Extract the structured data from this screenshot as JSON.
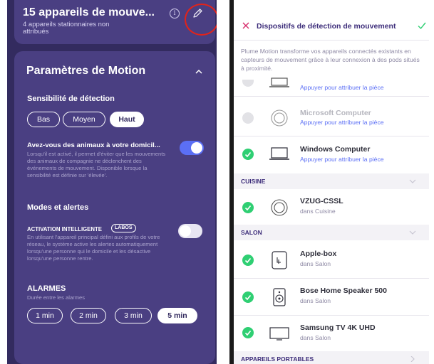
{
  "left_screen": {
    "summary": {
      "title": "15 appareils de mouve...",
      "subtitle": "4 appareils stationnaires non attribués",
      "info_icon": "info-icon",
      "edit_icon": "pencil-icon"
    },
    "panel": {
      "title": "Paramètres de Motion",
      "sensitivity": {
        "label": "Sensibilité de détection",
        "options": [
          "Bas",
          "Moyen",
          "Haut"
        ],
        "selected": "Haut"
      },
      "pets": {
        "label": "Avez-vous des animaux à votre domicil...",
        "description": "Lorsqu'il est activé, il permet d'éviter que les mouvements des animaux de compagnie ne déclenchent des événements de mouvement. Disponible lorsque la sensibilité est définie sur 'élevée'.",
        "enabled": true
      },
      "modes_label": "Modes et alertes",
      "smart_activation": {
        "label": "ACTIVATION INTELLIGENTE",
        "badge": "LABOS",
        "description": "En utilisant l'appareil principal défini aux profils de votre réseau, le système active les alertes automatiquement lorsqu'une personne qui le domicile et les désactive lorsqu'une personne rentre.",
        "enabled": false
      },
      "alarms": {
        "label": "ALARMES",
        "sublabel": "Durée entre les alarmes",
        "options": [
          "1 min",
          "2 min",
          "3 min",
          "5 min"
        ],
        "selected": "5 min"
      }
    }
  },
  "right_screen": {
    "header": {
      "title": "Dispositifs de détection de mouvement",
      "close_icon": "close-icon",
      "confirm_icon": "check-icon"
    },
    "intro": "Plume Motion transforme vos appareils connectés existants en capteurs de mouvement grâce à leur connexion à des pods situés à proximité.",
    "partial_row_link": "Appuyer pour attribuer la pièce",
    "unassigned": [
      {
        "name": "Microsoft Computer",
        "sub": "Appuyer pour attribuer la pièce",
        "checked": false,
        "icon": "computer-icon"
      },
      {
        "name": "Windows Computer",
        "sub": "Appuyer pour attribuer la pièce",
        "checked": true,
        "icon": "laptop-icon"
      }
    ],
    "sections": [
      {
        "label": "CUISINE",
        "devices": [
          {
            "name": "VZUG-CSSL",
            "sub": "dans Cuisine",
            "checked": true,
            "icon": "appliance-icon"
          }
        ]
      },
      {
        "label": "SALON",
        "devices": [
          {
            "name": "Apple-box",
            "sub": "dans Salon",
            "checked": true,
            "icon": "set-top-box-icon"
          },
          {
            "name": "Bose Home Speaker 500",
            "sub": "dans Salon",
            "checked": true,
            "icon": "speaker-icon"
          },
          {
            "name": "Samsung TV 4K UHD",
            "sub": "dans Salon",
            "checked": true,
            "icon": "tv-icon"
          }
        ]
      },
      {
        "label": "APPAREILS PORTABLES",
        "devices": []
      }
    ]
  },
  "colors": {
    "left_bg": "#332b5f",
    "card_bg": "#4a3f82",
    "toggle_on": "#5b6ff5",
    "check_green": "#2fcf73",
    "link_blue": "#5b6ff5",
    "annotation_red": "#e2231a",
    "title_purple": "#3d2d7a"
  }
}
